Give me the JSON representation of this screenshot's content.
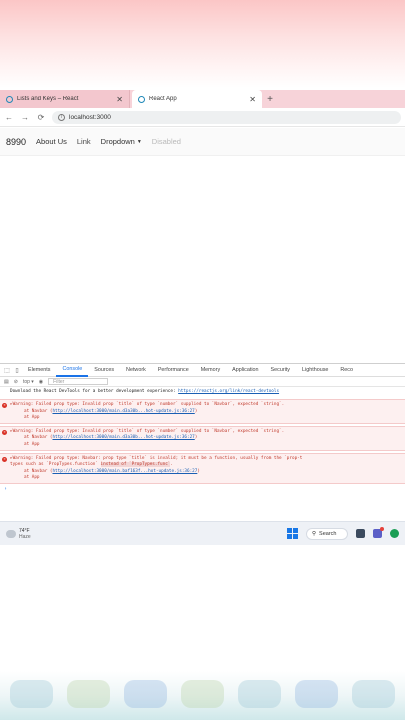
{
  "browser": {
    "tabs": [
      {
        "title": "Lists and Keys – React",
        "active": false
      },
      {
        "title": "React App",
        "active": true
      }
    ],
    "new_tab_icon": "+",
    "nav": {
      "back": "←",
      "forward": "→",
      "reload": "⟳"
    },
    "url": "localhost:3000"
  },
  "app_navbar": {
    "brand": "8990",
    "links": [
      "About Us",
      "Link"
    ],
    "dropdown": "Dropdown",
    "disabled": "Disabled"
  },
  "devtools": {
    "tabs": [
      "Elements",
      "Console",
      "Sources",
      "Network",
      "Performance",
      "Memory",
      "Application",
      "Security",
      "Lighthouse",
      "Reco"
    ],
    "active_tab": "Console",
    "context": "top ▾",
    "filter_placeholder": "Filter",
    "messages": {
      "info_text": "Download the React DevTools for a better development experience: ",
      "info_link": "https://reactjs.org/link/react-devtools",
      "w1_text": "▸Warning: Failed prop type: Invalid prop `title` of type `number` supplied to `Navbar`, expected `string`.",
      "w1_at1": "at Navbar (",
      "w1_link": "http://localhost:3000/main.d3a30b...hot-update.js:36:27",
      "w1_at1_end": ")",
      "w1_at2": "at App",
      "w2_text": "▸Warning: Failed prop type: Invalid prop `title` of type `number` supplied to `Navbar`, expected `string`.",
      "w2_at1": "at Navbar (",
      "w2_link": "http://localhost:3000/main.d3a30b...hot-update.js:36:27",
      "w2_at1_end": ")",
      "w2_at2": "at App",
      "w3_text": "▸Warning: Failed prop type: Navbar: prop type `title` is invalid; it must be a function, usually from the `prop-t",
      "w3_text2a": "types such as `PropTypes.function` ",
      "w3_text2b": "instead of `PropTypes.func`",
      "w3_text2c": ".",
      "w3_at1": "at Navbar (",
      "w3_link": "http://localhost:3000/main.baf163f...hot-update.js:36:27",
      "w3_at1_end": ")",
      "w3_at2": "at App",
      "prompt": "›"
    }
  },
  "taskbar": {
    "temperature": "74°F",
    "condition": "Haze",
    "search_label": "Search"
  }
}
